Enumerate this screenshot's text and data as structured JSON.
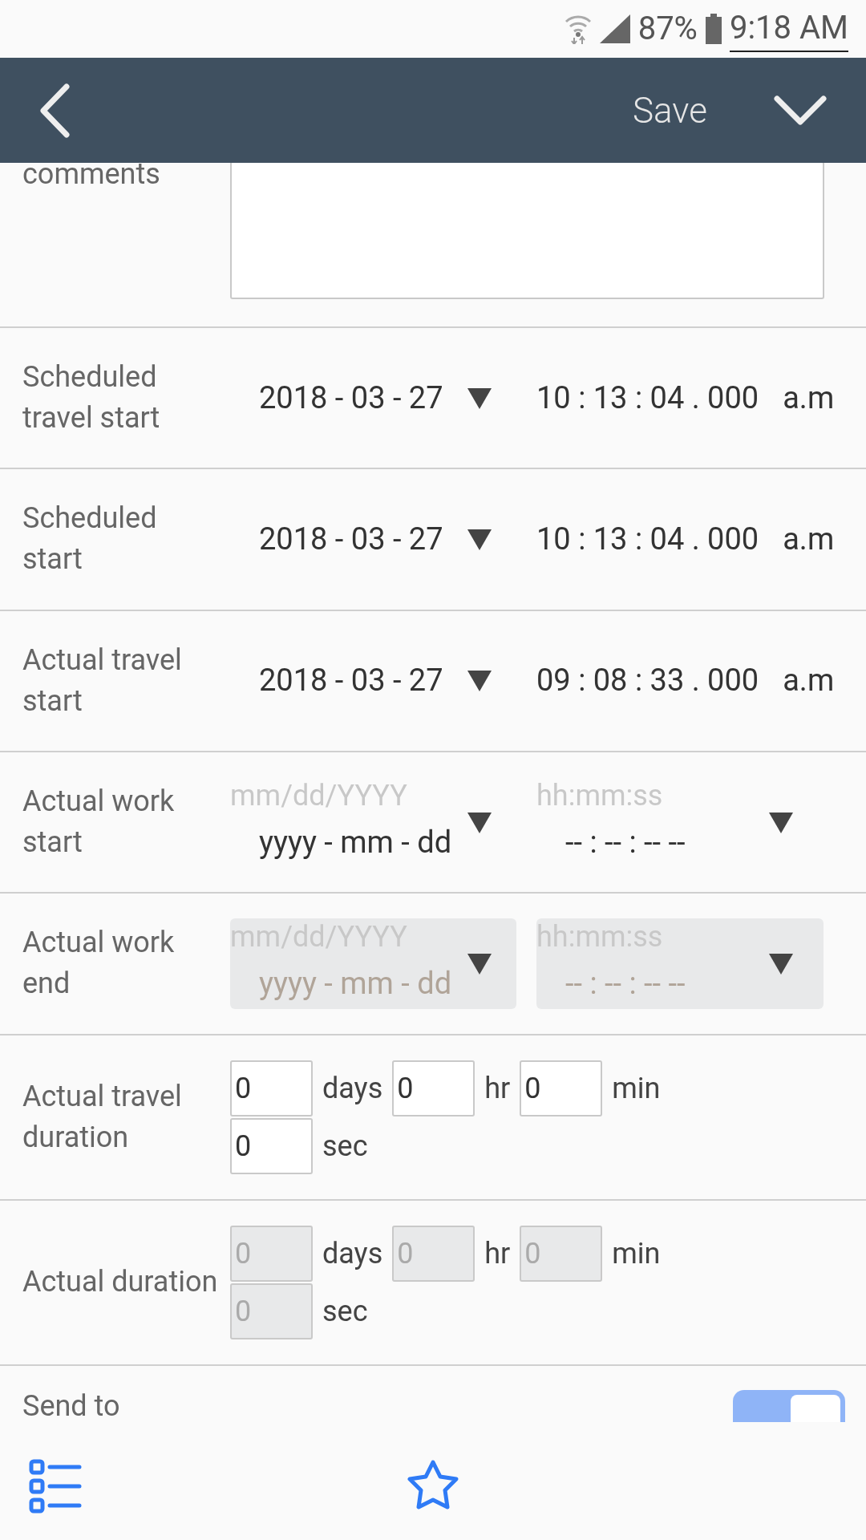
{
  "status_bar": {
    "battery": "87%",
    "time": "9:18 AM"
  },
  "header": {
    "save": "Save"
  },
  "comments": {
    "label": "comments"
  },
  "datetime_rows": [
    {
      "label": "Scheduled travel start",
      "disabled": false,
      "date": {
        "value": "2018 - 03 - 27"
      },
      "time": {
        "value": "10 : 13 : 04 . 000",
        "suffix": "a.m"
      }
    },
    {
      "label": "Scheduled start",
      "disabled": false,
      "date": {
        "value": "2018 - 03 - 27"
      },
      "time": {
        "value": "10 : 13 : 04 . 000",
        "suffix": "a.m"
      }
    },
    {
      "label": "Actual travel start",
      "disabled": false,
      "date": {
        "value": "2018 - 03 - 27"
      },
      "time": {
        "value": "09 : 08 : 33 . 000",
        "suffix": "a.m"
      }
    },
    {
      "label": "Actual work start",
      "disabled": false,
      "date": {
        "placeholder": "mm/dd/YYYY",
        "value": "yyyy - mm - dd"
      },
      "time": {
        "placeholder": "hh:mm:ss",
        "value": "-- : -- : -- --"
      }
    },
    {
      "label": "Actual work end",
      "disabled": true,
      "date": {
        "placeholder": "mm/dd/YYYY",
        "value": "yyyy - mm - dd"
      },
      "time": {
        "placeholder": "hh:mm:ss",
        "value": "-- : -- : -- --"
      }
    }
  ],
  "duration_rows": [
    {
      "label": "Actual travel duration",
      "disabled": false,
      "fields": [
        {
          "value": "0",
          "unit": "days"
        },
        {
          "value": "0",
          "unit": "hr"
        },
        {
          "value": "0",
          "unit": "min"
        },
        {
          "value": "0",
          "unit": "sec"
        }
      ]
    },
    {
      "label": "Actual duration",
      "disabled": true,
      "fields": [
        {
          "value": "0",
          "unit": "days"
        },
        {
          "value": "0",
          "unit": "hr"
        },
        {
          "value": "0",
          "unit": "min"
        },
        {
          "value": "0",
          "unit": "sec"
        }
      ]
    }
  ],
  "send_to": {
    "label": "Send to",
    "on": true
  }
}
